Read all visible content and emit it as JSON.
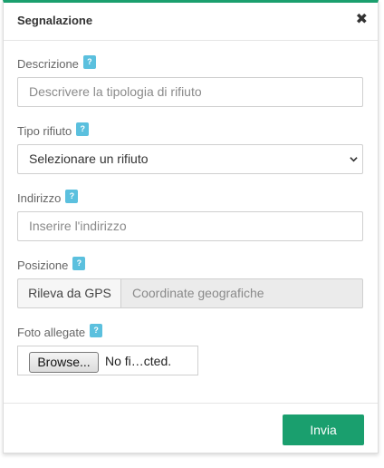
{
  "modal": {
    "title": "Segnalazione",
    "close_icon": "close-icon",
    "close_glyph": "✖"
  },
  "help_glyph": "?",
  "fields": {
    "descrizione": {
      "label": "Descrizione",
      "placeholder": "Descrivere la tipologia di rifiuto"
    },
    "tipo_rifiuto": {
      "label": "Tipo rifiuto",
      "selected": "Selezionare un rifiuto"
    },
    "indirizzo": {
      "label": "Indirizzo",
      "placeholder": "Inserire l'indirizzo"
    },
    "posizione": {
      "label": "Posizione",
      "gps_button": "Rileva da GPS",
      "coords_placeholder": "Coordinate geografiche"
    },
    "foto": {
      "label": "Foto allegate",
      "browse_button": "Browse...",
      "file_status": "No fi…cted."
    }
  },
  "footer": {
    "submit_label": "Invia"
  },
  "colors": {
    "accent": "#1a9f6e",
    "help_badge": "#5bc0de"
  }
}
